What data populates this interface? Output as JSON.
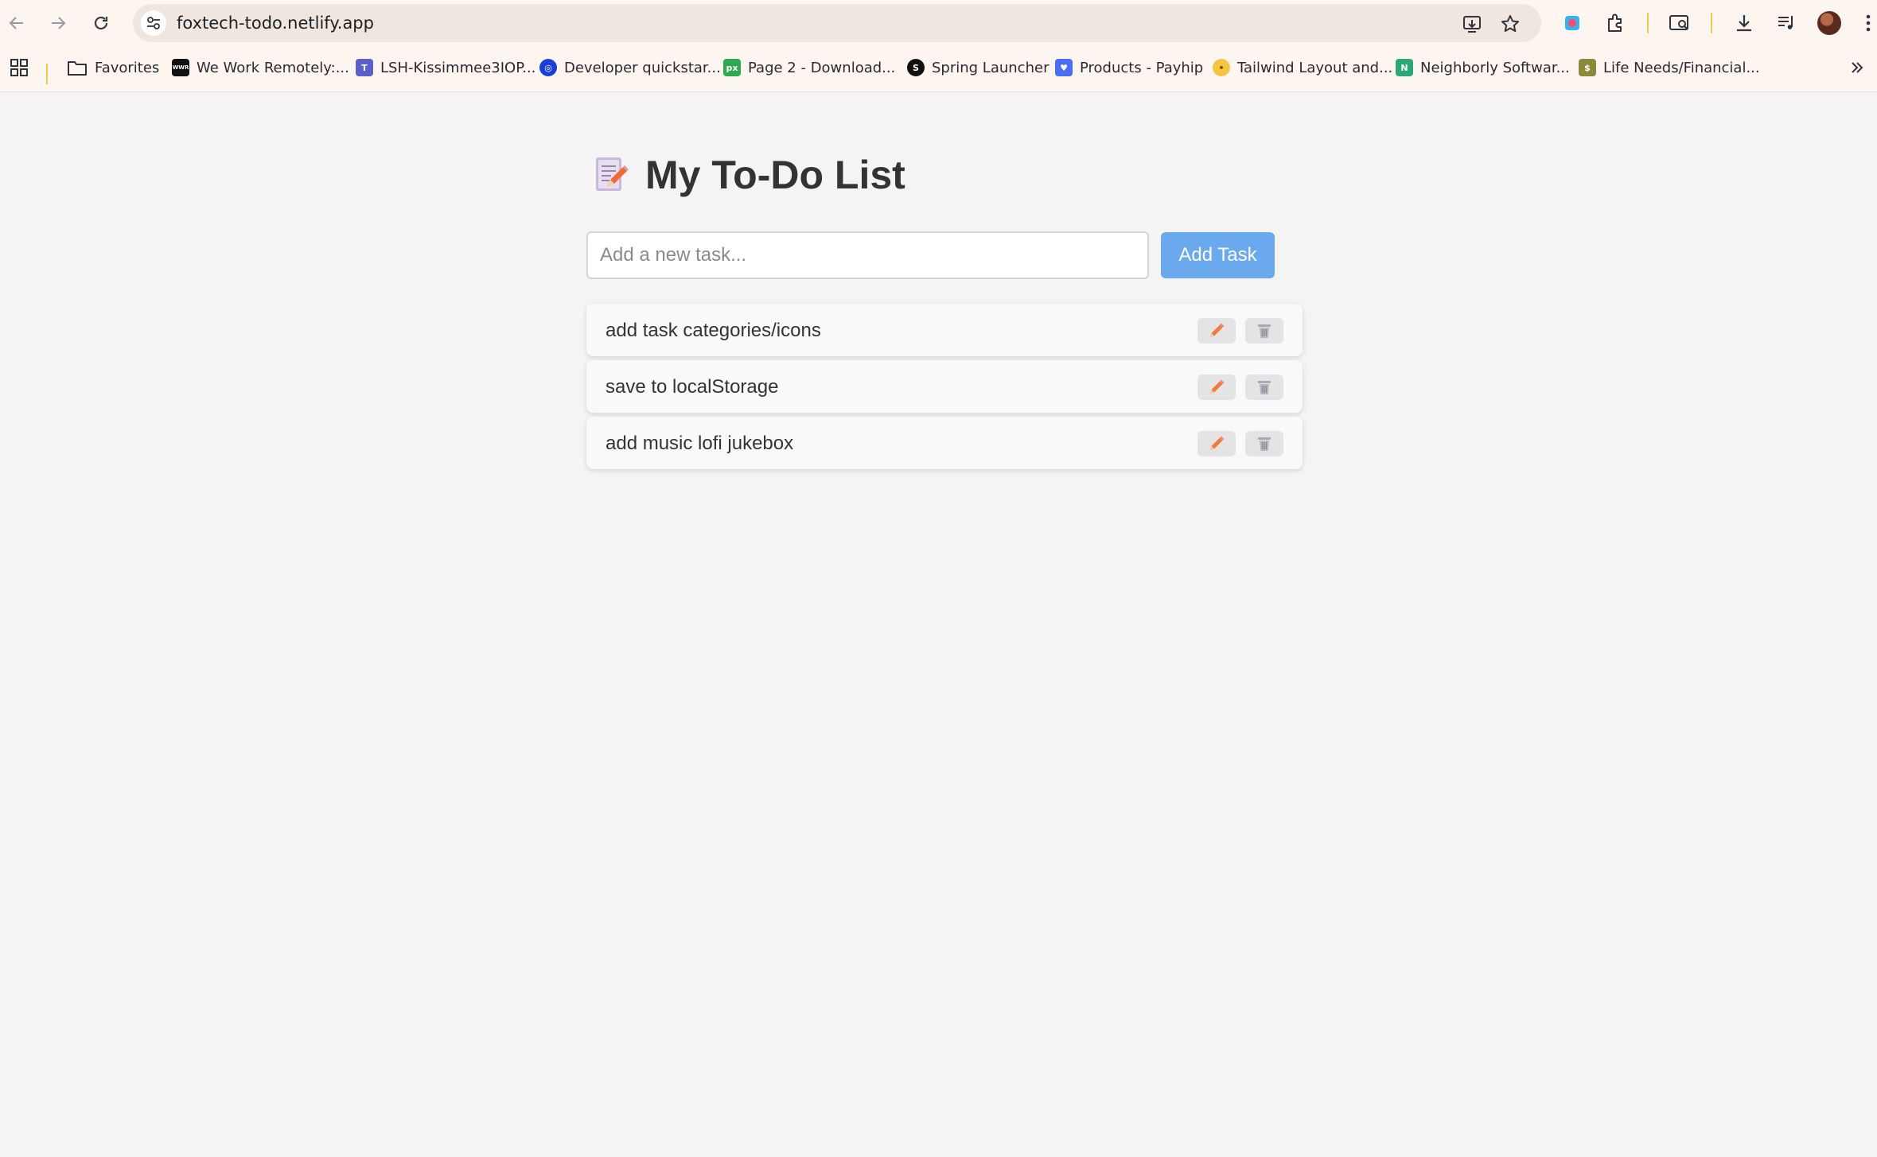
{
  "browser": {
    "url": "foxtech-todo.netlify.app",
    "bookmarks": [
      {
        "label": "Favorites",
        "icon": "folder-icon"
      },
      {
        "label": "We Work Remotely:...",
        "icon": "wwr-icon",
        "color": "#111111",
        "badge": "WWR"
      },
      {
        "label": "LSH-Kissimmee3IOP...",
        "icon": "teams-icon",
        "color": "#5b5fc7",
        "badge": "T"
      },
      {
        "label": "Developer quickstar...",
        "icon": "developer-icon",
        "color": "#1a3fd6",
        "badge": "◎"
      },
      {
        "label": "Page 2 - Download...",
        "icon": "px-icon",
        "color": "#2fa84f",
        "badge": "px"
      },
      {
        "label": "Spring Launcher",
        "icon": "spring-icon",
        "color": "#111111",
        "badge": "S"
      },
      {
        "label": "Products - Payhip",
        "icon": "payhip-icon",
        "color": "#4a6cf7",
        "badge": "♥"
      },
      {
        "label": "Tailwind Layout and...",
        "icon": "emoji-icon",
        "color": "#f4c542",
        "badge": "•"
      },
      {
        "label": "Neighborly Softwar...",
        "icon": "neighborly-icon",
        "color": "#2aa876",
        "badge": "N"
      },
      {
        "label": "Life Needs/Financial...",
        "icon": "financial-icon",
        "color": "#8a8a3a",
        "badge": "$"
      }
    ]
  },
  "app": {
    "title": "My To-Do List",
    "title_icon": "memo-icon",
    "input_placeholder": "Add a new task...",
    "input_value": "",
    "add_button_label": "Add Task",
    "accent_color": "#6aa9ee",
    "tasks": [
      {
        "text": "add task categories/icons",
        "edit_icon": "pencil-icon",
        "delete_icon": "trash-icon"
      },
      {
        "text": "save to localStorage",
        "edit_icon": "pencil-icon",
        "delete_icon": "trash-icon"
      },
      {
        "text": "add music lofi jukebox",
        "edit_icon": "pencil-icon",
        "delete_icon": "trash-icon"
      }
    ]
  }
}
